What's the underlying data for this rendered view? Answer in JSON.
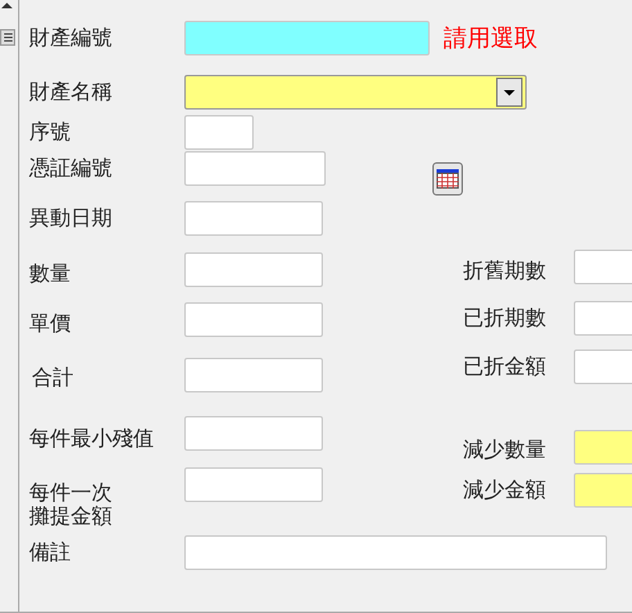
{
  "left_fields": [
    {
      "label": "財產編號",
      "kind": "text",
      "color": "#80ffff",
      "hint": "請用選取"
    },
    {
      "label": "財產名稱",
      "kind": "select",
      "color": "#ffff80"
    },
    {
      "label": "序號",
      "kind": "text"
    },
    {
      "label": "憑証編號",
      "kind": "text",
      "calendar": true
    },
    {
      "label": "異動日期",
      "kind": "text"
    },
    {
      "label": "數量",
      "kind": "text"
    },
    {
      "label": "單價",
      "kind": "text"
    },
    {
      "label": "合計",
      "kind": "text"
    },
    {
      "label": "每件最小殘值",
      "kind": "text"
    },
    {
      "label": "每件一次攤提金額",
      "kind": "text"
    },
    {
      "label": "備註",
      "kind": "text"
    }
  ],
  "right_fields": [
    {
      "label": "折舊期數",
      "kind": "text"
    },
    {
      "label": "已折期數",
      "kind": "text"
    },
    {
      "label": "已折金額",
      "kind": "text"
    },
    {
      "label": "減少數量",
      "kind": "text",
      "color": "#ffff80"
    },
    {
      "label": "減少金額",
      "kind": "text",
      "color": "#ffff80"
    }
  ]
}
